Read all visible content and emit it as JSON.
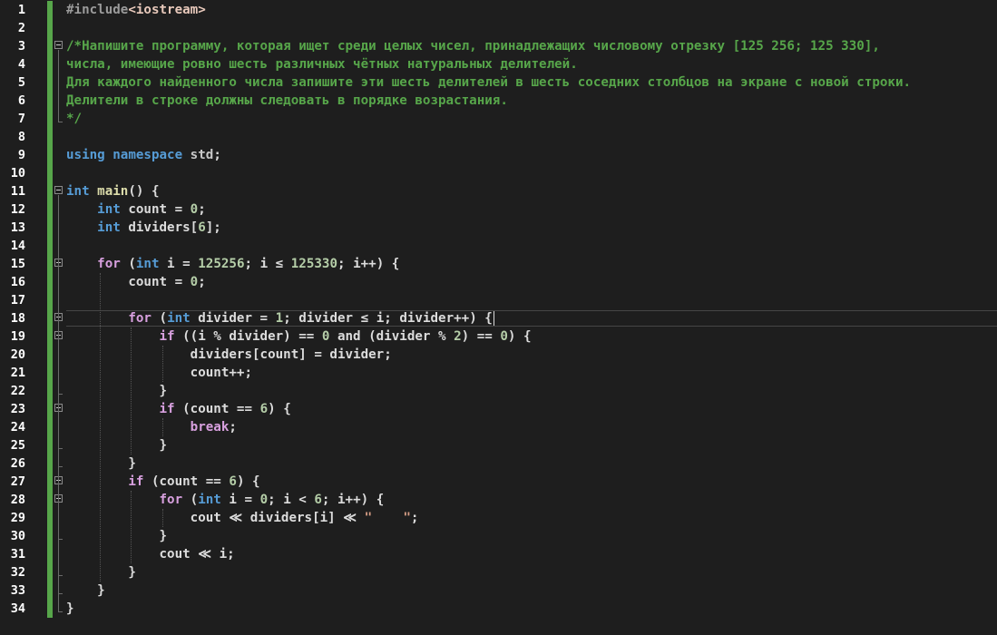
{
  "editor": {
    "language": "cpp",
    "theme": {
      "background": "#1e1e1e",
      "keyword": "#569cd6",
      "control": "#d8a0df",
      "comment": "#57a64a",
      "function": "#dcdcaa",
      "number": "#b5cea8",
      "string": "#d69d85",
      "text": "#dcdcdc",
      "line_number": "#ffffff",
      "change_bar": "#57a64a"
    },
    "current_line": 18,
    "lines": [
      {
        "n": "1",
        "tokens": [
          {
            "t": "#include",
            "c": "pp"
          },
          {
            "t": "<iostream>",
            "c": "inc"
          }
        ]
      },
      {
        "n": "2",
        "tokens": []
      },
      {
        "n": "3",
        "fold": true,
        "tokens": [
          {
            "t": "/*Напишите программу, которая ищет среди целых чисел, принадлежащих числовому отрезку [125 256; 125 330],",
            "c": "cm"
          }
        ]
      },
      {
        "n": "4",
        "tokens": [
          {
            "t": "числа, имеющие ровно шесть различных чётных натуральных делителей.",
            "c": "cm"
          }
        ]
      },
      {
        "n": "5",
        "tokens": [
          {
            "t": "Для каждого найденного числа запишите эти шесть делителей в шесть соседних столбцов на экране с новой строки.",
            "c": "cm"
          }
        ]
      },
      {
        "n": "6",
        "tokens": [
          {
            "t": "Делители в строке должны следовать в порядке возрастания.",
            "c": "cm"
          }
        ]
      },
      {
        "n": "7",
        "tokens": [
          {
            "t": "*/",
            "c": "cm"
          }
        ]
      },
      {
        "n": "8",
        "tokens": []
      },
      {
        "n": "9",
        "tokens": [
          {
            "t": "using",
            "c": "kw"
          },
          {
            "t": " ",
            "c": "tx"
          },
          {
            "t": "namespace",
            "c": "kw"
          },
          {
            "t": " std",
            "c": "ns"
          },
          {
            "t": ";",
            "c": "tx"
          }
        ]
      },
      {
        "n": "10",
        "tokens": []
      },
      {
        "n": "11",
        "fold": true,
        "tokens": [
          {
            "t": "int",
            "c": "kw"
          },
          {
            "t": " ",
            "c": "tx"
          },
          {
            "t": "main",
            "c": "fn"
          },
          {
            "t": "() {",
            "c": "tx"
          }
        ]
      },
      {
        "n": "12",
        "tokens": [
          {
            "t": "    ",
            "c": "tx"
          },
          {
            "t": "int",
            "c": "kw"
          },
          {
            "t": " count = ",
            "c": "tx"
          },
          {
            "t": "0",
            "c": "num"
          },
          {
            "t": ";",
            "c": "tx"
          }
        ]
      },
      {
        "n": "13",
        "tokens": [
          {
            "t": "    ",
            "c": "tx"
          },
          {
            "t": "int",
            "c": "kw"
          },
          {
            "t": " dividers[",
            "c": "tx"
          },
          {
            "t": "6",
            "c": "num"
          },
          {
            "t": "];",
            "c": "tx"
          }
        ]
      },
      {
        "n": "14",
        "tokens": []
      },
      {
        "n": "15",
        "fold": true,
        "tokens": [
          {
            "t": "    ",
            "c": "tx"
          },
          {
            "t": "for",
            "c": "ctl"
          },
          {
            "t": " (",
            "c": "tx"
          },
          {
            "t": "int",
            "c": "kw"
          },
          {
            "t": " i = ",
            "c": "tx"
          },
          {
            "t": "125256",
            "c": "num"
          },
          {
            "t": "; i ≤ ",
            "c": "tx"
          },
          {
            "t": "125330",
            "c": "num"
          },
          {
            "t": "; i++) {",
            "c": "tx"
          }
        ]
      },
      {
        "n": "16",
        "tokens": [
          {
            "t": "        count = ",
            "c": "tx"
          },
          {
            "t": "0",
            "c": "num"
          },
          {
            "t": ";",
            "c": "tx"
          }
        ]
      },
      {
        "n": "17",
        "tokens": []
      },
      {
        "n": "18",
        "fold": true,
        "current": true,
        "tokens": [
          {
            "t": "        ",
            "c": "tx"
          },
          {
            "t": "for",
            "c": "ctl"
          },
          {
            "t": " (",
            "c": "tx"
          },
          {
            "t": "int",
            "c": "kw"
          },
          {
            "t": " divider = ",
            "c": "tx"
          },
          {
            "t": "1",
            "c": "num"
          },
          {
            "t": "; divider ≤ i; divider++) {",
            "c": "tx"
          }
        ]
      },
      {
        "n": "19",
        "fold": true,
        "tokens": [
          {
            "t": "            ",
            "c": "tx"
          },
          {
            "t": "if",
            "c": "ctl"
          },
          {
            "t": " ((i % divider) == ",
            "c": "tx"
          },
          {
            "t": "0",
            "c": "num"
          },
          {
            "t": " and (divider % ",
            "c": "tx"
          },
          {
            "t": "2",
            "c": "num"
          },
          {
            "t": ") == ",
            "c": "tx"
          },
          {
            "t": "0",
            "c": "num"
          },
          {
            "t": ") {",
            "c": "tx"
          }
        ]
      },
      {
        "n": "20",
        "tokens": [
          {
            "t": "                dividers[count] = divider;",
            "c": "tx"
          }
        ]
      },
      {
        "n": "21",
        "tokens": [
          {
            "t": "                count++;",
            "c": "tx"
          }
        ]
      },
      {
        "n": "22",
        "tokens": [
          {
            "t": "            }",
            "c": "tx"
          }
        ]
      },
      {
        "n": "23",
        "fold": true,
        "tokens": [
          {
            "t": "            ",
            "c": "tx"
          },
          {
            "t": "if",
            "c": "ctl"
          },
          {
            "t": " (count == ",
            "c": "tx"
          },
          {
            "t": "6",
            "c": "num"
          },
          {
            "t": ") {",
            "c": "tx"
          }
        ]
      },
      {
        "n": "24",
        "tokens": [
          {
            "t": "                ",
            "c": "tx"
          },
          {
            "t": "break",
            "c": "ctl"
          },
          {
            "t": ";",
            "c": "tx"
          }
        ]
      },
      {
        "n": "25",
        "tokens": [
          {
            "t": "            }",
            "c": "tx"
          }
        ]
      },
      {
        "n": "26",
        "tokens": [
          {
            "t": "        }",
            "c": "tx"
          }
        ]
      },
      {
        "n": "27",
        "fold": true,
        "tokens": [
          {
            "t": "        ",
            "c": "tx"
          },
          {
            "t": "if",
            "c": "ctl"
          },
          {
            "t": " (count == ",
            "c": "tx"
          },
          {
            "t": "6",
            "c": "num"
          },
          {
            "t": ") {",
            "c": "tx"
          }
        ]
      },
      {
        "n": "28",
        "fold": true,
        "tokens": [
          {
            "t": "            ",
            "c": "tx"
          },
          {
            "t": "for",
            "c": "ctl"
          },
          {
            "t": " (",
            "c": "tx"
          },
          {
            "t": "int",
            "c": "kw"
          },
          {
            "t": " i = ",
            "c": "tx"
          },
          {
            "t": "0",
            "c": "num"
          },
          {
            "t": "; i < ",
            "c": "tx"
          },
          {
            "t": "6",
            "c": "num"
          },
          {
            "t": "; i++) {",
            "c": "tx"
          }
        ]
      },
      {
        "n": "29",
        "tokens": [
          {
            "t": "                cout ≪ dividers[i] ≪ ",
            "c": "tx"
          },
          {
            "t": "\"    \"",
            "c": "str"
          },
          {
            "t": ";",
            "c": "tx"
          }
        ]
      },
      {
        "n": "30",
        "tokens": [
          {
            "t": "            }",
            "c": "tx"
          }
        ]
      },
      {
        "n": "31",
        "tokens": [
          {
            "t": "            cout ≪ i;",
            "c": "tx"
          }
        ]
      },
      {
        "n": "32",
        "tokens": [
          {
            "t": "        }",
            "c": "tx"
          }
        ]
      },
      {
        "n": "33",
        "tokens": [
          {
            "t": "    }",
            "c": "tx"
          }
        ]
      },
      {
        "n": "34",
        "tokens": [
          {
            "t": "}",
            "c": "tx"
          }
        ]
      }
    ]
  }
}
